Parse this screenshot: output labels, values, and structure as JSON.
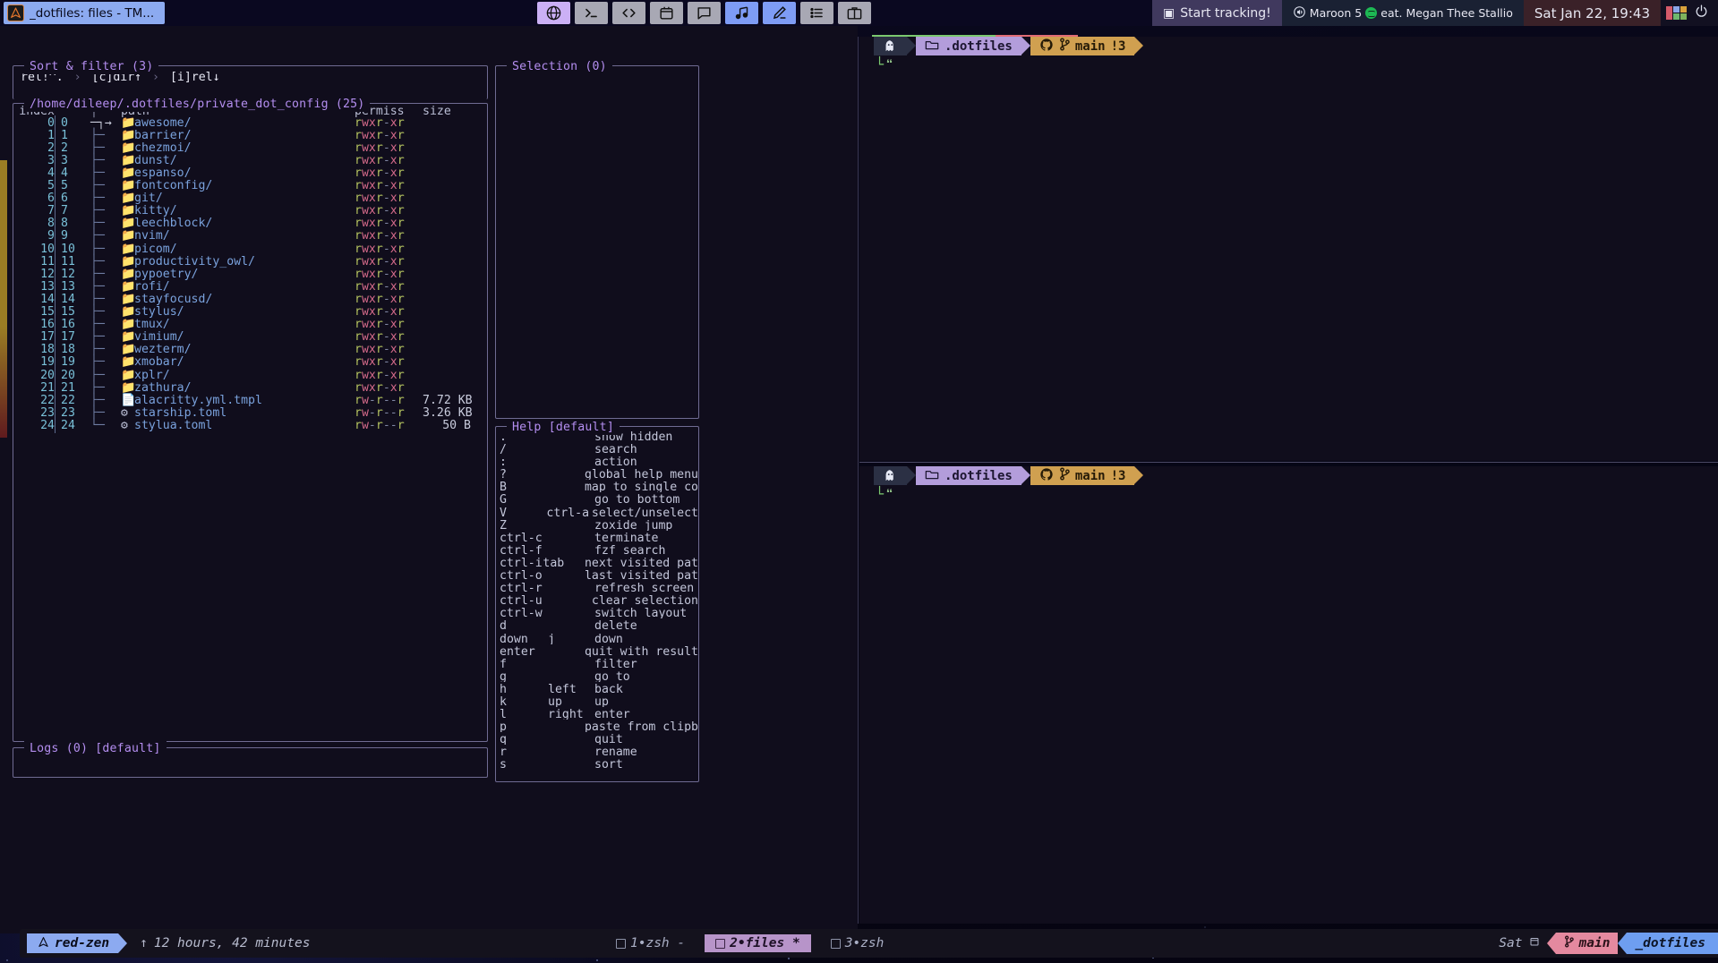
{
  "topbar": {
    "window_title": "_dotfiles: files - TM...",
    "window_icon": "arch-logo-icon",
    "tray_icons": [
      {
        "name": "globe-icon",
        "state": "active-purple"
      },
      {
        "name": "terminal-icon",
        "state": "normal"
      },
      {
        "name": "code-icon",
        "state": "normal"
      },
      {
        "name": "calendar-icon",
        "state": "normal"
      },
      {
        "name": "chat-icon",
        "state": "normal"
      },
      {
        "name": "music-icon",
        "state": "active-blue"
      },
      {
        "name": "pencil-icon",
        "state": "active-blue"
      },
      {
        "name": "list-icon",
        "state": "normal"
      },
      {
        "name": "briefcase-icon",
        "state": "normal"
      }
    ],
    "tracking_label": "Start tracking!",
    "music_text": "Maroon 5",
    "music_text2": "eat. Megan Thee Stallio",
    "clock": "Sat Jan 22, 19:43",
    "power_icon": "power-icon"
  },
  "xplr": {
    "sort_filter": {
      "title": "Sort & filter (3)",
      "parts": [
        "rel!^.",
        "[c]dir↑",
        "[i]rel↓"
      ],
      "separator": "›"
    },
    "explorer": {
      "title": "/home/dileep/.dotfiles/private_dot_config (25)",
      "headers": {
        "index": "index",
        "tree": "",
        "path": "path",
        "permiss": "permiss",
        "size": "size"
      },
      "rows": [
        {
          "i": "0",
          "j": "0",
          "tree": "─┐→",
          "icon": "folder-icon",
          "name": "awesome/",
          "perm": "rwxr-xr",
          "size": "",
          "cursor": true
        },
        {
          "i": "1",
          "j": "1",
          "tree": "├─",
          "icon": "folder-icon",
          "name": "barrier/",
          "perm": "rwxr-xr",
          "size": ""
        },
        {
          "i": "2",
          "j": "2",
          "tree": "├─",
          "icon": "folder-icon",
          "name": "chezmoi/",
          "perm": "rwxr-xr",
          "size": ""
        },
        {
          "i": "3",
          "j": "3",
          "tree": "├─",
          "icon": "folder-icon",
          "name": "dunst/",
          "perm": "rwxr-xr",
          "size": ""
        },
        {
          "i": "4",
          "j": "4",
          "tree": "├─",
          "icon": "folder-icon",
          "name": "espanso/",
          "perm": "rwxr-xr",
          "size": ""
        },
        {
          "i": "5",
          "j": "5",
          "tree": "├─",
          "icon": "folder-icon",
          "name": "fontconfig/",
          "perm": "rwxr-xr",
          "size": ""
        },
        {
          "i": "6",
          "j": "6",
          "tree": "├─",
          "icon": "folder-icon",
          "name": "git/",
          "perm": "rwxr-xr",
          "size": ""
        },
        {
          "i": "7",
          "j": "7",
          "tree": "├─",
          "icon": "folder-icon",
          "name": "kitty/",
          "perm": "rwxr-xr",
          "size": ""
        },
        {
          "i": "8",
          "j": "8",
          "tree": "├─",
          "icon": "folder-icon",
          "name": "leechblock/",
          "perm": "rwxr-xr",
          "size": ""
        },
        {
          "i": "9",
          "j": "9",
          "tree": "├─",
          "icon": "folder-icon",
          "name": "nvim/",
          "perm": "rwxr-xr",
          "size": ""
        },
        {
          "i": "10",
          "j": "10",
          "tree": "├─",
          "icon": "folder-icon",
          "name": "picom/",
          "perm": "rwxr-xr",
          "size": ""
        },
        {
          "i": "11",
          "j": "11",
          "tree": "├─",
          "icon": "folder-icon",
          "name": "productivity_owl/",
          "perm": "rwxr-xr",
          "size": ""
        },
        {
          "i": "12",
          "j": "12",
          "tree": "├─",
          "icon": "folder-icon",
          "name": "pypoetry/",
          "perm": "rwxr-xr",
          "size": ""
        },
        {
          "i": "13",
          "j": "13",
          "tree": "├─",
          "icon": "folder-icon",
          "name": "rofi/",
          "perm": "rwxr-xr",
          "size": ""
        },
        {
          "i": "14",
          "j": "14",
          "tree": "├─",
          "icon": "folder-icon",
          "name": "stayfocusd/",
          "perm": "rwxr-xr",
          "size": ""
        },
        {
          "i": "15",
          "j": "15",
          "tree": "├─",
          "icon": "folder-icon",
          "name": "stylus/",
          "perm": "rwxr-xr",
          "size": ""
        },
        {
          "i": "16",
          "j": "16",
          "tree": "├─",
          "icon": "folder-icon",
          "name": "tmux/",
          "perm": "rwxr-xr",
          "size": ""
        },
        {
          "i": "17",
          "j": "17",
          "tree": "├─",
          "icon": "folder-icon",
          "name": "vimium/",
          "perm": "rwxr-xr",
          "size": ""
        },
        {
          "i": "18",
          "j": "18",
          "tree": "├─",
          "icon": "folder-icon",
          "name": "wezterm/",
          "perm": "rwxr-xr",
          "size": ""
        },
        {
          "i": "19",
          "j": "19",
          "tree": "├─",
          "icon": "folder-icon",
          "name": "xmobar/",
          "perm": "rwxr-xr",
          "size": ""
        },
        {
          "i": "20",
          "j": "20",
          "tree": "├─",
          "icon": "folder-icon",
          "name": "xplr/",
          "perm": "rwxr-xr",
          "size": ""
        },
        {
          "i": "21",
          "j": "21",
          "tree": "├─",
          "icon": "folder-icon",
          "name": "zathura/",
          "perm": "rwxr-xr",
          "size": ""
        },
        {
          "i": "22",
          "j": "22",
          "tree": "├─",
          "icon": "file-icon",
          "name": "alacritty.yml.tmpl",
          "perm": "rw-r--r",
          "size": "7.72 KB"
        },
        {
          "i": "23",
          "j": "23",
          "tree": "├─",
          "icon": "gear-icon",
          "name": "starship.toml",
          "perm": "rw-r--r",
          "size": "3.26 KB"
        },
        {
          "i": "24",
          "j": "24",
          "tree": "└─",
          "icon": "gear-icon",
          "name": "stylua.toml",
          "perm": "rw-r--r",
          "size": "50 B"
        }
      ]
    },
    "logs": {
      "title": "Logs (0) [default]"
    },
    "selection": {
      "title": "Selection (0)"
    },
    "help": {
      "title": "Help [default]",
      "rows": [
        {
          "k1": ".",
          "k2": "",
          "d": "show hidden"
        },
        {
          "k1": "/",
          "k2": "",
          "d": "search"
        },
        {
          "k1": ":",
          "k2": "",
          "d": "action"
        },
        {
          "k1": "?",
          "k2": "",
          "d": "global help menu"
        },
        {
          "k1": "B",
          "k2": "",
          "d": "map to single co"
        },
        {
          "k1": "G",
          "k2": "",
          "d": "go to bottom"
        },
        {
          "k1": "V",
          "k2": "ctrl-a",
          "d": "select/unselect"
        },
        {
          "k1": "Z",
          "k2": "",
          "d": "zoxide jump"
        },
        {
          "k1": "ctrl-c",
          "k2": "",
          "d": "terminate"
        },
        {
          "k1": "ctrl-f",
          "k2": "",
          "d": "fzf search"
        },
        {
          "k1": "ctrl-i",
          "k2": "tab",
          "d": "next visited pat"
        },
        {
          "k1": "ctrl-o",
          "k2": "",
          "d": "last visited pat"
        },
        {
          "k1": "ctrl-r",
          "k2": "",
          "d": "refresh screen"
        },
        {
          "k1": "ctrl-u",
          "k2": "",
          "d": "clear selection"
        },
        {
          "k1": "ctrl-w",
          "k2": "",
          "d": "switch layout"
        },
        {
          "k1": "d",
          "k2": "",
          "d": "delete"
        },
        {
          "k1": "down",
          "k2": "j",
          "d": "down"
        },
        {
          "k1": "enter",
          "k2": "",
          "d": "quit with result"
        },
        {
          "k1": "f",
          "k2": "",
          "d": "filter"
        },
        {
          "k1": "g",
          "k2": "",
          "d": "go to"
        },
        {
          "k1": "h",
          "k2": "left",
          "d": "back"
        },
        {
          "k1": "k",
          "k2": "up",
          "d": "up"
        },
        {
          "k1": "l",
          "k2": "right",
          "d": "enter"
        },
        {
          "k1": "p",
          "k2": "",
          "d": "paste from clipb"
        },
        {
          "k1": "q",
          "k2": "",
          "d": "quit"
        },
        {
          "k1": "r",
          "k2": "",
          "d": "rename"
        },
        {
          "k1": "s",
          "k2": "",
          "d": "sort"
        }
      ]
    }
  },
  "panes": {
    "top": {
      "ghost_icon": "ghost-icon",
      "dir_icon": "folder-icon",
      "dir": ".dotfiles",
      "git_icon": "github-icon",
      "branch_icon": "git-branch-icon",
      "branch": "main",
      "dirty": "!3"
    },
    "bottom": {
      "ghost_icon": "ghost-icon",
      "dir_icon": "folder-icon",
      "dir": ".dotfiles",
      "git_icon": "github-icon",
      "branch_icon": "git-branch-icon",
      "branch": "main",
      "dirty": "!3"
    }
  },
  "tmux": {
    "host": "red-zen",
    "host_icon": "arch-icon",
    "uptime_icon": "uptime-arrow-icon",
    "uptime": "12 hours, 42 minutes",
    "windows": [
      {
        "label": "1•zsh",
        "suffix": "-",
        "active": false
      },
      {
        "label": "2•files",
        "suffix": "*",
        "active": true
      },
      {
        "label": "3•zsh",
        "suffix": "",
        "active": false
      }
    ],
    "date": "Sat",
    "branch": "main",
    "session": "_dotfiles"
  },
  "colors": {
    "accent_purple": "#b48ef0",
    "dir_blue": "#7aa2dd",
    "perm_green": "#b3c25f",
    "perm_red": "#d46a8a",
    "tmux_active": "#b794c9",
    "host_blue": "#8caaf0",
    "branch_pink": "#e4899f",
    "session_blue": "#6e9ef0",
    "prompt_green": "#7bc96f"
  }
}
